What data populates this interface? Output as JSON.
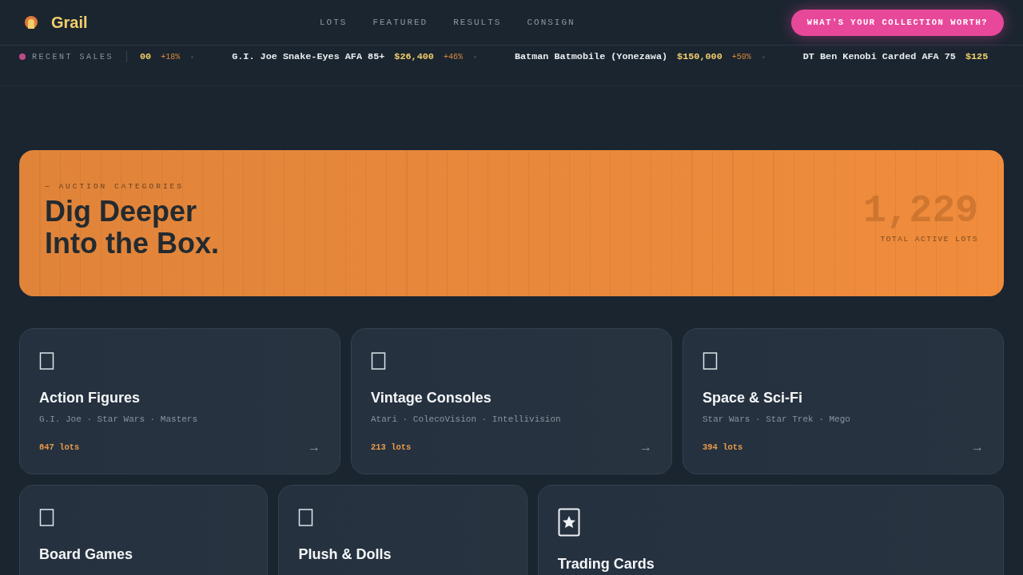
{
  "brand": {
    "name": "Grail"
  },
  "nav": [
    {
      "label": "LOTS"
    },
    {
      "label": "FEATURED"
    },
    {
      "label": "RESULTS"
    },
    {
      "label": "CONSIGN"
    }
  ],
  "cta": {
    "label": "WHAT'S YOUR COLLECTION WORTH?"
  },
  "ticker": {
    "label": "RECENT SALES",
    "items": [
      {
        "price": "00",
        "change": "+18%"
      },
      {
        "name": "G.I. Joe Snake-Eyes AFA 85+",
        "price": "$26,400",
        "change": "+46%"
      },
      {
        "name": "Batman Batmobile (Yonezawa)",
        "price": "$150,000",
        "change": "+50%"
      },
      {
        "name": "DT Ben Kenobi Carded AFA 75",
        "price": "$125"
      }
    ]
  },
  "hero": {
    "eyebrow": "— AUCTION CATEGORIES",
    "title_lines": [
      "Dig Deeper",
      "Into the Box."
    ],
    "count": "1,229",
    "count_label": "TOTAL ACTIVE LOTS"
  },
  "category_rows": [
    [
      {
        "kind": "placeholder",
        "title": "Action Figures",
        "tags": "G.I. Joe · Star Wars · Masters",
        "lots": "847 lots",
        "arrow": "→"
      },
      {
        "kind": "placeholder",
        "title": "Vintage Consoles",
        "tags": "Atari · ColecoVision · Intellivision",
        "lots": "213 lots",
        "arrow": "→"
      },
      {
        "kind": "placeholder",
        "title": "Space & Sci-Fi",
        "tags": "Star Wars · Star Trek · Mego",
        "lots": "394 lots",
        "arrow": "→"
      }
    ],
    [
      {
        "kind": "placeholder",
        "title": "Board Games"
      },
      {
        "kind": "placeholder",
        "title": "Plush & Dolls"
      },
      {
        "kind": "star-card",
        "title": "Trading Cards",
        "wide": true
      }
    ]
  ]
}
